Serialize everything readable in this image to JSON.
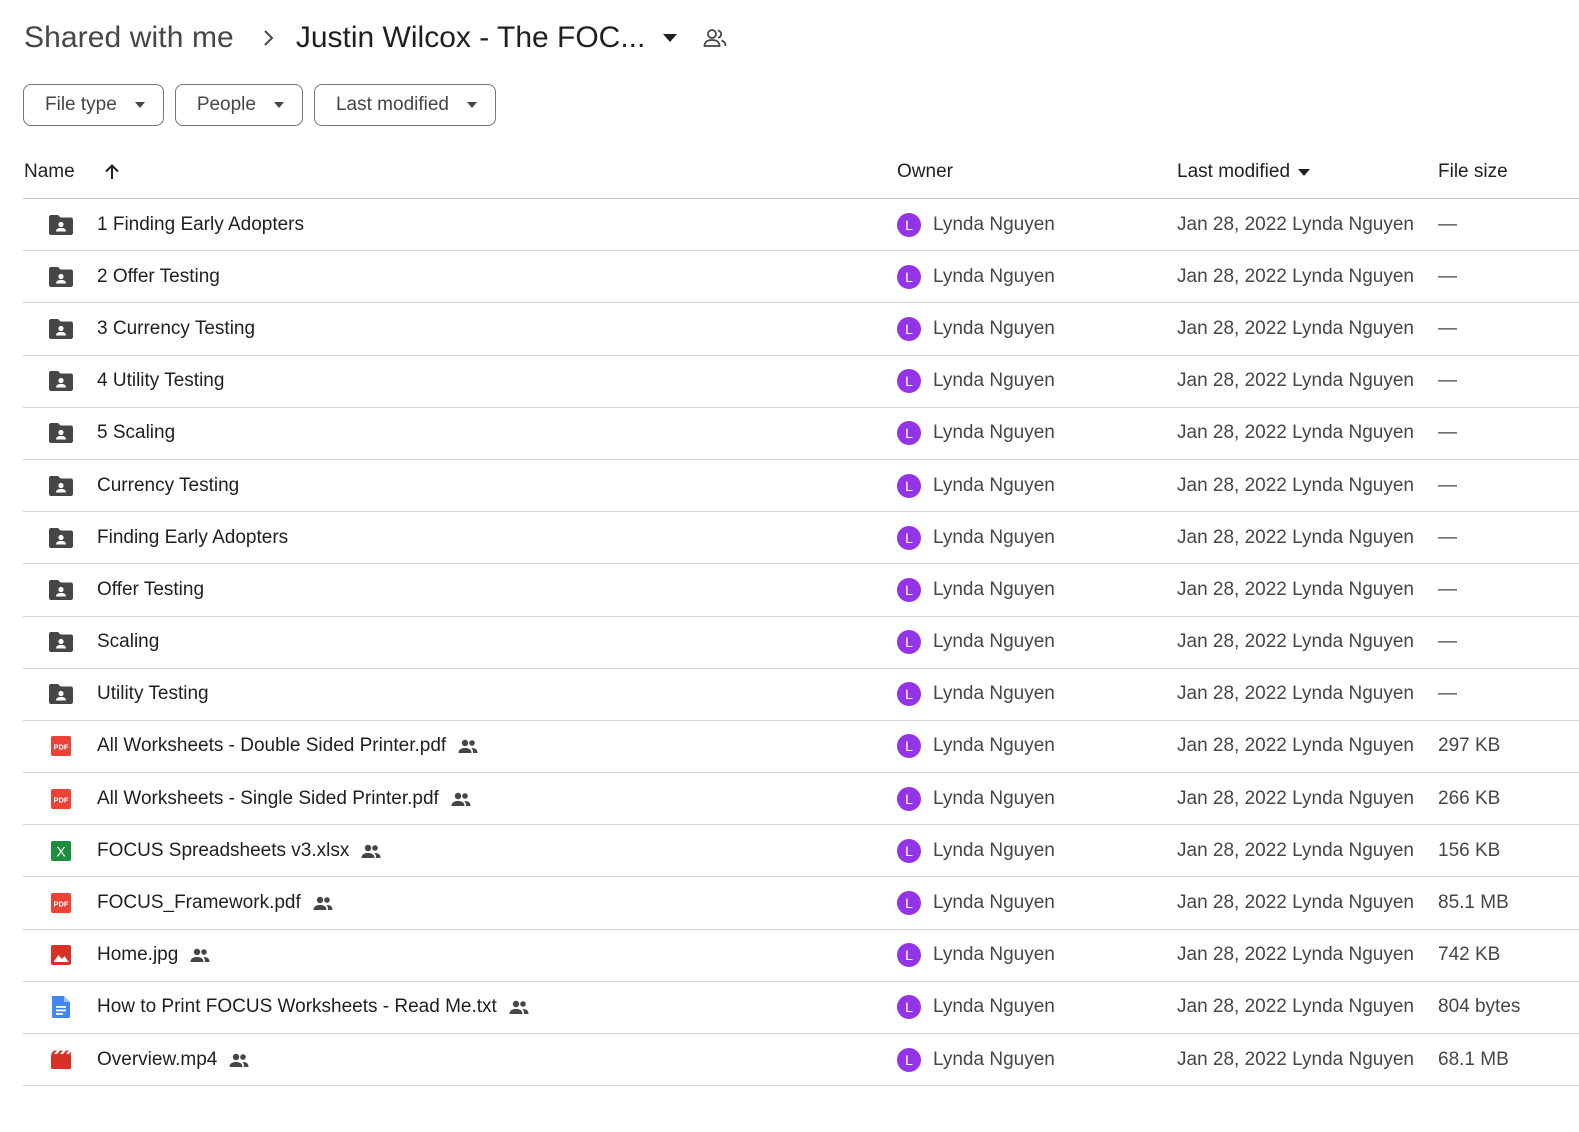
{
  "breadcrumb": {
    "parent": "Shared with me",
    "current": "Justin Wilcox - The FOC..."
  },
  "filters": [
    {
      "label": "File type"
    },
    {
      "label": "People"
    },
    {
      "label": "Last modified"
    }
  ],
  "table": {
    "headers": {
      "name": "Name",
      "owner": "Owner",
      "last_modified": "Last modified",
      "file_size": "File size"
    },
    "rows": [
      {
        "name": "1 Finding Early Adopters",
        "icon": "shared-folder-icon",
        "shared": false,
        "owner_initial": "L",
        "owner": "Lynda Nguyen",
        "modified": "Jan 28, 2022 Lynda Nguyen",
        "size": "—"
      },
      {
        "name": "2 Offer Testing",
        "icon": "shared-folder-icon",
        "shared": false,
        "owner_initial": "L",
        "owner": "Lynda Nguyen",
        "modified": "Jan 28, 2022 Lynda Nguyen",
        "size": "—"
      },
      {
        "name": "3 Currency Testing",
        "icon": "shared-folder-icon",
        "shared": false,
        "owner_initial": "L",
        "owner": "Lynda Nguyen",
        "modified": "Jan 28, 2022 Lynda Nguyen",
        "size": "—"
      },
      {
        "name": "4 Utility Testing",
        "icon": "shared-folder-icon",
        "shared": false,
        "owner_initial": "L",
        "owner": "Lynda Nguyen",
        "modified": "Jan 28, 2022 Lynda Nguyen",
        "size": "—"
      },
      {
        "name": "5 Scaling",
        "icon": "shared-folder-icon",
        "shared": false,
        "owner_initial": "L",
        "owner": "Lynda Nguyen",
        "modified": "Jan 28, 2022 Lynda Nguyen",
        "size": "—"
      },
      {
        "name": "Currency Testing",
        "icon": "shared-folder-icon",
        "shared": false,
        "owner_initial": "L",
        "owner": "Lynda Nguyen",
        "modified": "Jan 28, 2022 Lynda Nguyen",
        "size": "—"
      },
      {
        "name": "Finding Early Adopters",
        "icon": "shared-folder-icon",
        "shared": false,
        "owner_initial": "L",
        "owner": "Lynda Nguyen",
        "modified": "Jan 28, 2022 Lynda Nguyen",
        "size": "—"
      },
      {
        "name": "Offer Testing",
        "icon": "shared-folder-icon",
        "shared": false,
        "owner_initial": "L",
        "owner": "Lynda Nguyen",
        "modified": "Jan 28, 2022 Lynda Nguyen",
        "size": "—"
      },
      {
        "name": "Scaling",
        "icon": "shared-folder-icon",
        "shared": false,
        "owner_initial": "L",
        "owner": "Lynda Nguyen",
        "modified": "Jan 28, 2022 Lynda Nguyen",
        "size": "—"
      },
      {
        "name": "Utility Testing",
        "icon": "shared-folder-icon",
        "shared": false,
        "owner_initial": "L",
        "owner": "Lynda Nguyen",
        "modified": "Jan 28, 2022 Lynda Nguyen",
        "size": "—"
      },
      {
        "name": "All Worksheets - Double Sided Printer.pdf",
        "icon": "pdf-icon",
        "shared": true,
        "owner_initial": "L",
        "owner": "Lynda Nguyen",
        "modified": "Jan 28, 2022 Lynda Nguyen",
        "size": "297 KB"
      },
      {
        "name": "All Worksheets - Single Sided Printer.pdf",
        "icon": "pdf-icon",
        "shared": true,
        "owner_initial": "L",
        "owner": "Lynda Nguyen",
        "modified": "Jan 28, 2022 Lynda Nguyen",
        "size": "266 KB"
      },
      {
        "name": "FOCUS Spreadsheets v3.xlsx",
        "icon": "excel-icon",
        "shared": true,
        "owner_initial": "L",
        "owner": "Lynda Nguyen",
        "modified": "Jan 28, 2022 Lynda Nguyen",
        "size": "156 KB"
      },
      {
        "name": "FOCUS_Framework.pdf",
        "icon": "pdf-icon",
        "shared": true,
        "owner_initial": "L",
        "owner": "Lynda Nguyen",
        "modified": "Jan 28, 2022 Lynda Nguyen",
        "size": "85.1 MB"
      },
      {
        "name": "Home.jpg",
        "icon": "image-icon",
        "shared": true,
        "owner_initial": "L",
        "owner": "Lynda Nguyen",
        "modified": "Jan 28, 2022 Lynda Nguyen",
        "size": "742 KB"
      },
      {
        "name": "How to Print FOCUS Worksheets - Read Me.txt",
        "icon": "document-icon",
        "shared": true,
        "owner_initial": "L",
        "owner": "Lynda Nguyen",
        "modified": "Jan 28, 2022 Lynda Nguyen",
        "size": "804 bytes"
      },
      {
        "name": "Overview.mp4",
        "icon": "video-icon",
        "shared": true,
        "owner_initial": "L",
        "owner": "Lynda Nguyen",
        "modified": "Jan 28, 2022 Lynda Nguyen",
        "size": "68.1 MB"
      }
    ]
  },
  "icon_labels": {
    "pdf": "PDF",
    "excel": "X"
  },
  "colors": {
    "avatar": "#9334e6",
    "folder": "#444746",
    "pdf": "#ea4335",
    "excel": "#1e8e3e",
    "image": "#d93025",
    "document": "#4285f4",
    "video": "#d93025"
  }
}
